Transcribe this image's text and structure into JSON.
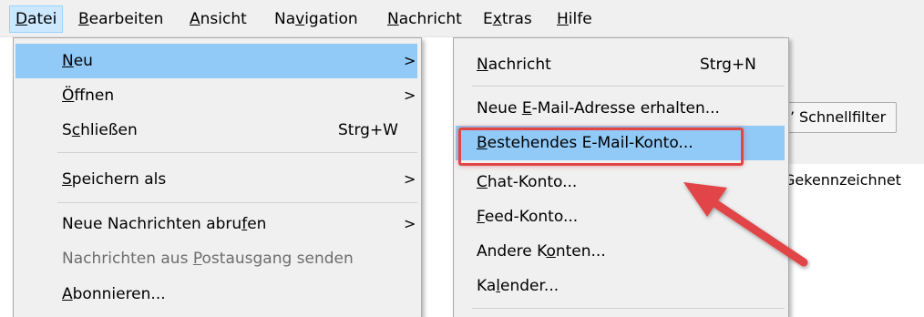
{
  "menubar": {
    "items": [
      {
        "label": "Datei",
        "mnemonic": "D",
        "active": true
      },
      {
        "label": "Bearbeiten",
        "mnemonic": "B"
      },
      {
        "label": "Ansicht",
        "mnemonic": "A"
      },
      {
        "label": "Navigation",
        "mnemonic": "v"
      },
      {
        "label": "Nachricht",
        "mnemonic": "N"
      },
      {
        "label": "Extras",
        "mnemonic": "x"
      },
      {
        "label": "Hilfe",
        "mnemonic": "H"
      }
    ]
  },
  "file_menu": {
    "items": [
      {
        "label": "Neu",
        "mnemonic": "N",
        "submenu": true,
        "highlighted": true
      },
      {
        "label": "Öffnen",
        "mnemonic": "Ö",
        "submenu": true
      },
      {
        "label": "Schließen",
        "mnemonic": "c",
        "shortcut": "Strg+W"
      },
      {
        "label": "Speichern als",
        "mnemonic": "S",
        "submenu": true
      },
      {
        "label": "Neue Nachrichten abrufen",
        "mnemonic": "f",
        "submenu": true
      },
      {
        "label": "Nachrichten aus Postausgang senden",
        "mnemonic": "P",
        "disabled": true
      },
      {
        "label": "Abonnieren...",
        "mnemonic": "A"
      }
    ],
    "arrow_glyph": ">"
  },
  "new_submenu": {
    "items": [
      {
        "label": "Nachricht",
        "mnemonic": "N",
        "shortcut": "Strg+N"
      },
      {
        "label": "Neue E-Mail-Adresse erhalten...",
        "mnemonic": "E"
      },
      {
        "label": "Bestehendes E-Mail-Konto...",
        "mnemonic": "B",
        "highlighted": true
      },
      {
        "label": "Chat-Konto...",
        "mnemonic": "C"
      },
      {
        "label": "Feed-Konto...",
        "mnemonic": "F"
      },
      {
        "label": "Andere Konten...",
        "mnemonic": "o"
      },
      {
        "label": "Kalender...",
        "mnemonic": "l"
      }
    ]
  },
  "background_window": {
    "quick_filter_label": "Schnellfilter",
    "quick_filter_icon": "pin-icon",
    "flagged_label": "Gekennzeichnet"
  },
  "annotation": {
    "highlight_color": "#e14546"
  }
}
